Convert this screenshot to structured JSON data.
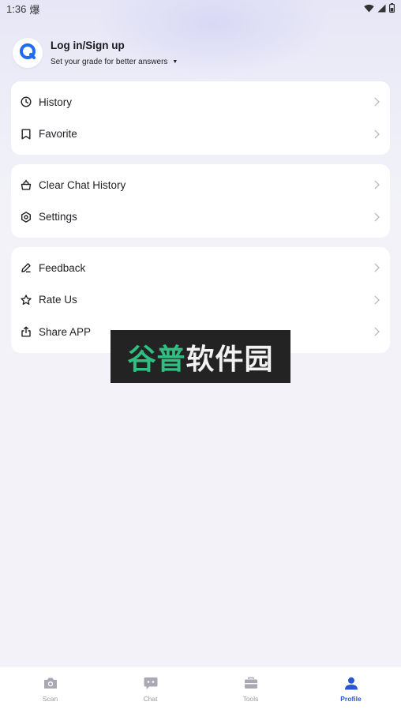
{
  "status": {
    "time": "1:36",
    "notification_glyph": "爆"
  },
  "header": {
    "login_label": "Log in/Sign up",
    "grade_label": "Set your grade for better answers",
    "accent_color": "#1f6bf2"
  },
  "cards": [
    {
      "items": [
        {
          "icon": "clock-icon",
          "label": "History"
        },
        {
          "icon": "bookmark-icon",
          "label": "Favorite"
        }
      ]
    },
    {
      "items": [
        {
          "icon": "broom-icon",
          "label": "Clear Chat History"
        },
        {
          "icon": "gear-icon",
          "label": "Settings"
        }
      ]
    },
    {
      "items": [
        {
          "icon": "pencil-icon",
          "label": "Feedback"
        },
        {
          "icon": "star-icon",
          "label": "Rate Us"
        },
        {
          "icon": "share-icon",
          "label": "Share APP"
        }
      ]
    }
  ],
  "watermark": {
    "green_text": "谷普",
    "white_text": "软件园"
  },
  "tabbar": {
    "active_color": "#2a56d6",
    "tabs": [
      {
        "icon": "camera-icon",
        "label": "Scan"
      },
      {
        "icon": "chat-icon",
        "label": "Chat"
      },
      {
        "icon": "toolbox-icon",
        "label": "Tools"
      },
      {
        "icon": "person-icon",
        "label": "Profile",
        "active": true
      }
    ]
  }
}
